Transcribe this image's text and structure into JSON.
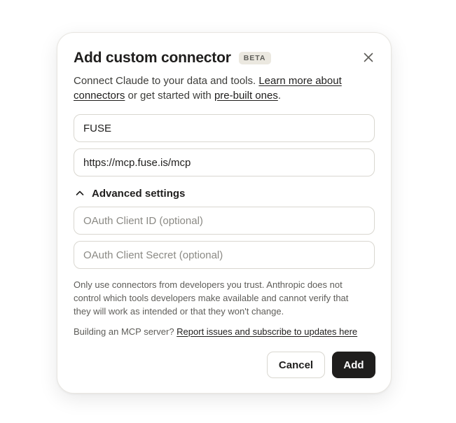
{
  "dialog": {
    "title": "Add custom connector",
    "badge": "BETA",
    "close_icon": "close-icon",
    "description": {
      "text_before": "Connect Claude to your data and tools. ",
      "link_learn_more": "Learn more about connectors",
      "text_middle": " or get started with ",
      "link_prebuilt": "pre-built ones",
      "text_after": "."
    }
  },
  "fields": {
    "name": {
      "value": "FUSE",
      "placeholder": ""
    },
    "url": {
      "value": "https://mcp.fuse.is/mcp",
      "placeholder": ""
    },
    "client_id": {
      "value": "",
      "placeholder": "OAuth Client ID (optional)"
    },
    "client_secret": {
      "value": "",
      "placeholder": "OAuth Client Secret (optional)"
    }
  },
  "advanced": {
    "label": "Advanced settings",
    "icon": "chevron-up-icon",
    "expanded": true
  },
  "warning": "Only use connectors from developers you trust. Anthropic does not control which tools developers make available and cannot verify that they will work as intended or that they won't change.",
  "footer_note": {
    "text": "Building an MCP server? ",
    "link": "Report issues and subscribe to updates here"
  },
  "buttons": {
    "cancel": "Cancel",
    "add": "Add"
  },
  "colors": {
    "primary_button_bg": "#1f1e1d",
    "badge_bg": "#ebe8e0",
    "text_primary": "#1f1e1d",
    "text_secondary": "#5e5d59",
    "border": "#d9d7d0"
  }
}
